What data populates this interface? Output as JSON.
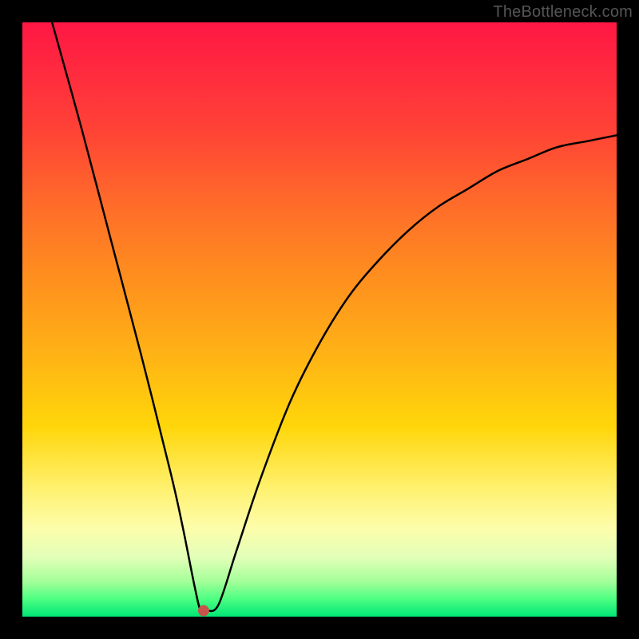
{
  "watermark": "TheBottleneck.com",
  "chart_data": {
    "type": "line",
    "title": "",
    "xlabel": "",
    "ylabel": "",
    "xlim": [
      0,
      100
    ],
    "ylim": [
      0,
      100
    ],
    "grid": false,
    "series": [
      {
        "name": "curve",
        "x": [
          5,
          10,
          15,
          20,
          25,
          27,
          29,
          30,
          31,
          33,
          36,
          40,
          45,
          50,
          55,
          60,
          65,
          70,
          75,
          80,
          85,
          90,
          95,
          100
        ],
        "values": [
          100,
          82,
          63,
          44,
          24,
          15,
          5,
          1,
          1,
          2,
          11,
          23,
          36,
          46,
          54,
          60,
          65,
          69,
          72,
          75,
          77,
          79,
          80,
          81
        ]
      }
    ],
    "marker": {
      "x": 30.5,
      "y": 1,
      "color": "#c9534a",
      "radius_px": 7
    }
  },
  "colors": {
    "frame": "#000000",
    "curve": "#000000",
    "marker": "#c9534a"
  }
}
